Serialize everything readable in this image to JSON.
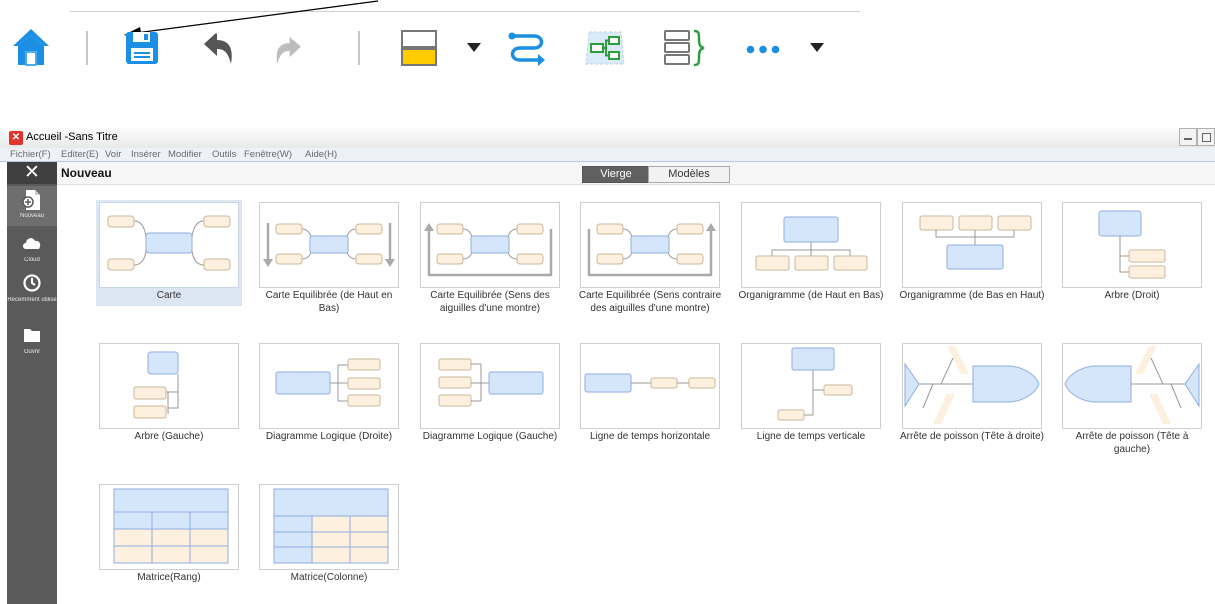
{
  "toolbar": {
    "icons": [
      "home-icon",
      "save-icon",
      "undo-icon",
      "redo-icon",
      "topic-style-icon",
      "dropdown-arrow-icon",
      "relationship-icon",
      "boundary-icon",
      "summary-icon",
      "more-icon",
      "dropdown-arrow-icon"
    ]
  },
  "window": {
    "title": "Accueil -Sans Titre",
    "logo": "✕"
  },
  "menu": [
    "Fichier(F)",
    "Editer(E)",
    "Voir",
    "Insérer",
    "Modifier",
    "Outils",
    "Fenêtre(W)",
    "Aide(H)"
  ],
  "sidebar": {
    "close": "✕",
    "items": [
      {
        "label": "Nouveau",
        "icon": "new-file-icon",
        "active": true
      },
      {
        "label": "Cloud",
        "icon": "cloud-icon",
        "active": false
      },
      {
        "label": "Récemment utilisé",
        "icon": "clock-icon",
        "active": false
      },
      {
        "label": "Ouvrir",
        "icon": "folder-icon",
        "active": false
      }
    ]
  },
  "header": {
    "title": "Nouveau",
    "tabs": [
      "Vierge",
      "Modèles"
    ],
    "active_tab": "Vierge"
  },
  "templates": [
    {
      "label": "Carte",
      "kind": "map"
    },
    {
      "label": "Carte Equilibrée (de Haut en Bas)",
      "kind": "map-down"
    },
    {
      "label": "Carte Equilibrée (Sens des aiguilles d'une montre)",
      "kind": "map-cw"
    },
    {
      "label": "Carte Equilibrée (Sens contraire des aiguilles d'une montre)",
      "kind": "map-ccw"
    },
    {
      "label": "Organigramme (de Haut en Bas)",
      "kind": "org-down"
    },
    {
      "label": "Organigramme (de Bas en Haut)",
      "kind": "org-up"
    },
    {
      "label": "Arbre (Droit)",
      "kind": "tree-right"
    },
    {
      "label": "Arbre (Gauche)",
      "kind": "tree-left"
    },
    {
      "label": "Diagramme Logique (Droite)",
      "kind": "logic-right"
    },
    {
      "label": "Diagramme Logique (Gauche)",
      "kind": "logic-left"
    },
    {
      "label": "Ligne de temps horizontale",
      "kind": "timeline-h"
    },
    {
      "label": "Ligne de temps verticale",
      "kind": "timeline-v"
    },
    {
      "label": "Arrête de poisson (Tête à droite)",
      "kind": "fish-right"
    },
    {
      "label": "Arrête de poisson (Tête à gauche)",
      "kind": "fish-left"
    },
    {
      "label": "Matrice(Rang)",
      "kind": "matrix-row"
    },
    {
      "label": "Matrice(Colonne)",
      "kind": "matrix-col"
    }
  ],
  "selected_template": "Carte",
  "colors": {
    "accent": "#1a8fe3",
    "topic_fill": "#d6e6fa",
    "topic_stroke": "#8eaee0",
    "subtopic_fill": "#fdf0de",
    "subtopic_stroke": "#c9b79a",
    "sidebar_bg": "#5a5a5a"
  }
}
